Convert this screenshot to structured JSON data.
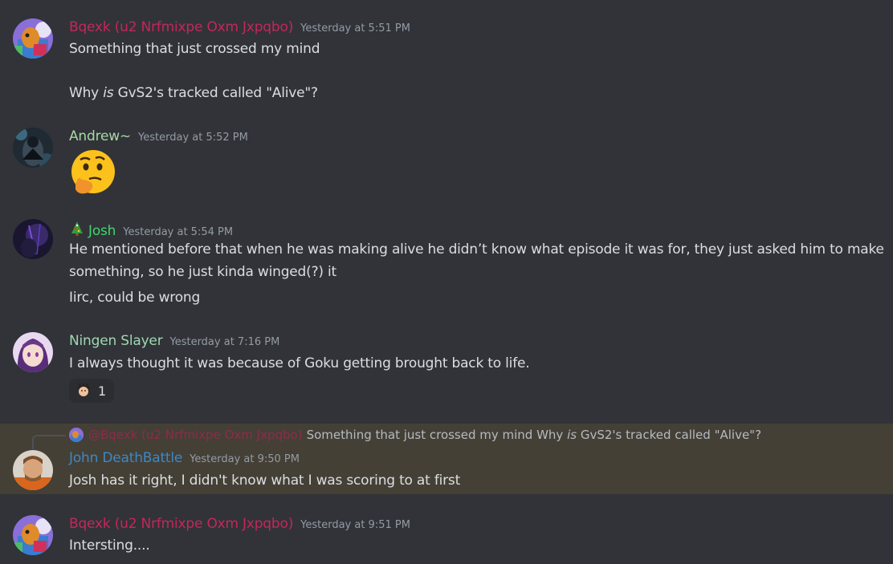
{
  "colors": {
    "background": "#313338",
    "bqexk": "#c4275a",
    "andrew": "#a8d8a4",
    "josh": "#3fd66b",
    "ningen": "#9fd8b2",
    "john": "#3e87c4",
    "highlight": "#444036"
  },
  "messages": [
    {
      "username": "Bqexk (u2 Nrfmixpe Oxm Jxpqbo)",
      "timestamp": "Yesterday at 5:51 PM",
      "line1": "Something that just crossed my mind",
      "line2_a": "Why ",
      "line2_em": "is",
      "line2_b": " GvS2's tracked called \"Alive\"?"
    },
    {
      "username": "Andrew~",
      "timestamp": "Yesterday at 5:52 PM",
      "emoji": "thinking-face-emoji"
    },
    {
      "username": "Josh",
      "timestamp": "Yesterday at 5:54 PM",
      "badge": "christmas-tree-icon",
      "line1": "He mentioned before that when he was making alive he didn’t know what episode it was for, they just asked him to make something, so he just kinda winged(?) it",
      "line2": "Iirc, could be wrong"
    },
    {
      "username": "Ningen Slayer",
      "timestamp": "Yesterday at 7:16 PM",
      "line1": "I always thought it was because of Goku getting brought back to life.",
      "reaction_icon": "goku-face-emoji",
      "reaction_count": "1"
    },
    {
      "reply_to_name": "@Bqexk (u2 Nrfmixpe Oxm Jxpqbo)",
      "reply_text_a": "Something that just crossed my mind Why ",
      "reply_text_em": "is",
      "reply_text_b": " GvS2's tracked called \"Alive\"?",
      "username": "John DeathBattle",
      "timestamp": "Yesterday at 9:50 PM",
      "line1": "Josh has it right, I didn't know what I was scoring to at first"
    },
    {
      "username": "Bqexk (u2 Nrfmixpe Oxm Jxpqbo)",
      "timestamp": "Yesterday at 9:51 PM",
      "line1": "Intersting...."
    }
  ]
}
